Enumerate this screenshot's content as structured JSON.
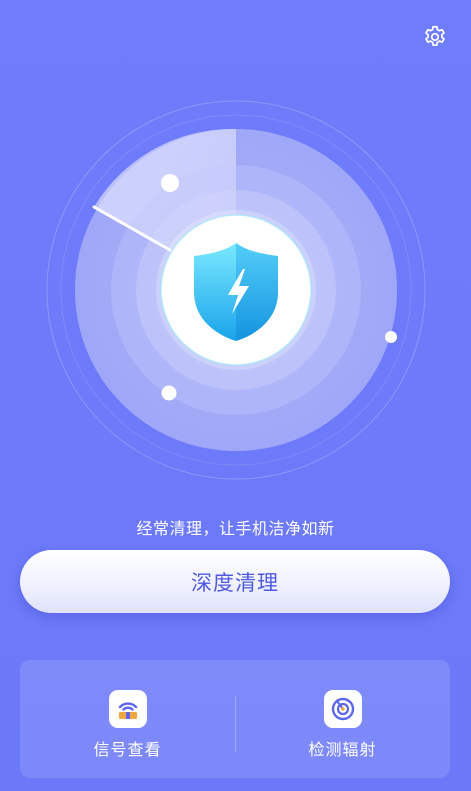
{
  "header": {
    "settings_icon": "gear-icon"
  },
  "scanner": {
    "center_icon": "shield-lightning-icon"
  },
  "tagline": "经常清理，让手机洁净如新",
  "actions": {
    "deep_clean_label": "深度清理"
  },
  "tools": [
    {
      "label": "信号查看",
      "icon": "router-icon"
    },
    {
      "label": "检测辐射",
      "icon": "radiation-scan-icon"
    }
  ],
  "colors": {
    "background": "#6e7bfa",
    "button_text": "#4f59e0",
    "shield_light": "#6fe7ff",
    "shield_dark": "#1fa7ea"
  }
}
